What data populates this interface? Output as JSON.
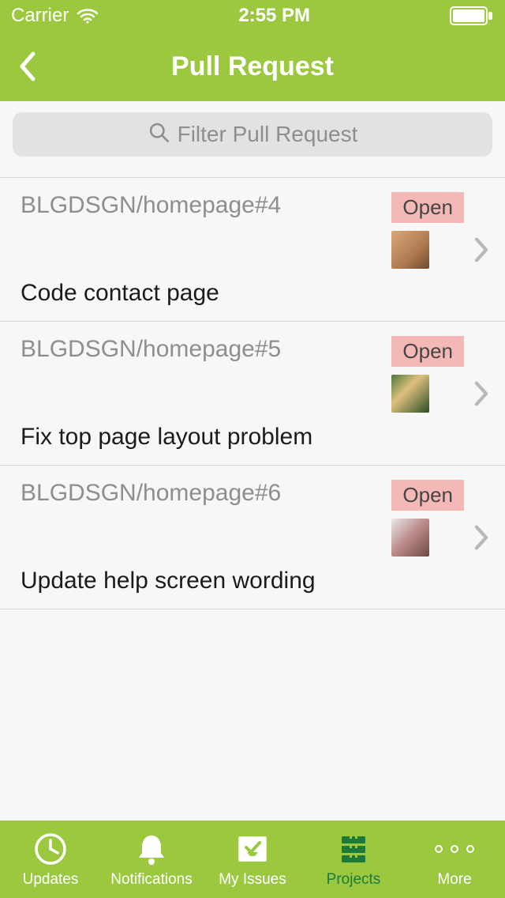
{
  "status_bar": {
    "carrier": "Carrier",
    "time": "2:55 PM"
  },
  "header": {
    "title": "Pull Request"
  },
  "search": {
    "placeholder": "Filter Pull Request"
  },
  "rows": [
    {
      "ref": "BLGDSGN/homepage#4",
      "badge": "Open",
      "title": "Code contact page"
    },
    {
      "ref": "BLGDSGN/homepage#5",
      "badge": "Open",
      "title": "Fix top page layout problem"
    },
    {
      "ref": "BLGDSGN/homepage#6",
      "badge": "Open",
      "title": "Update help screen wording"
    }
  ],
  "tabs": {
    "updates": "Updates",
    "notifications": "Notifications",
    "my_issues": "My Issues",
    "projects": "Projects",
    "more": "More"
  },
  "colors": {
    "brand": "#9bc83f",
    "badge_bg": "#f4b9b7",
    "active_tab": "#1d7a3a"
  }
}
